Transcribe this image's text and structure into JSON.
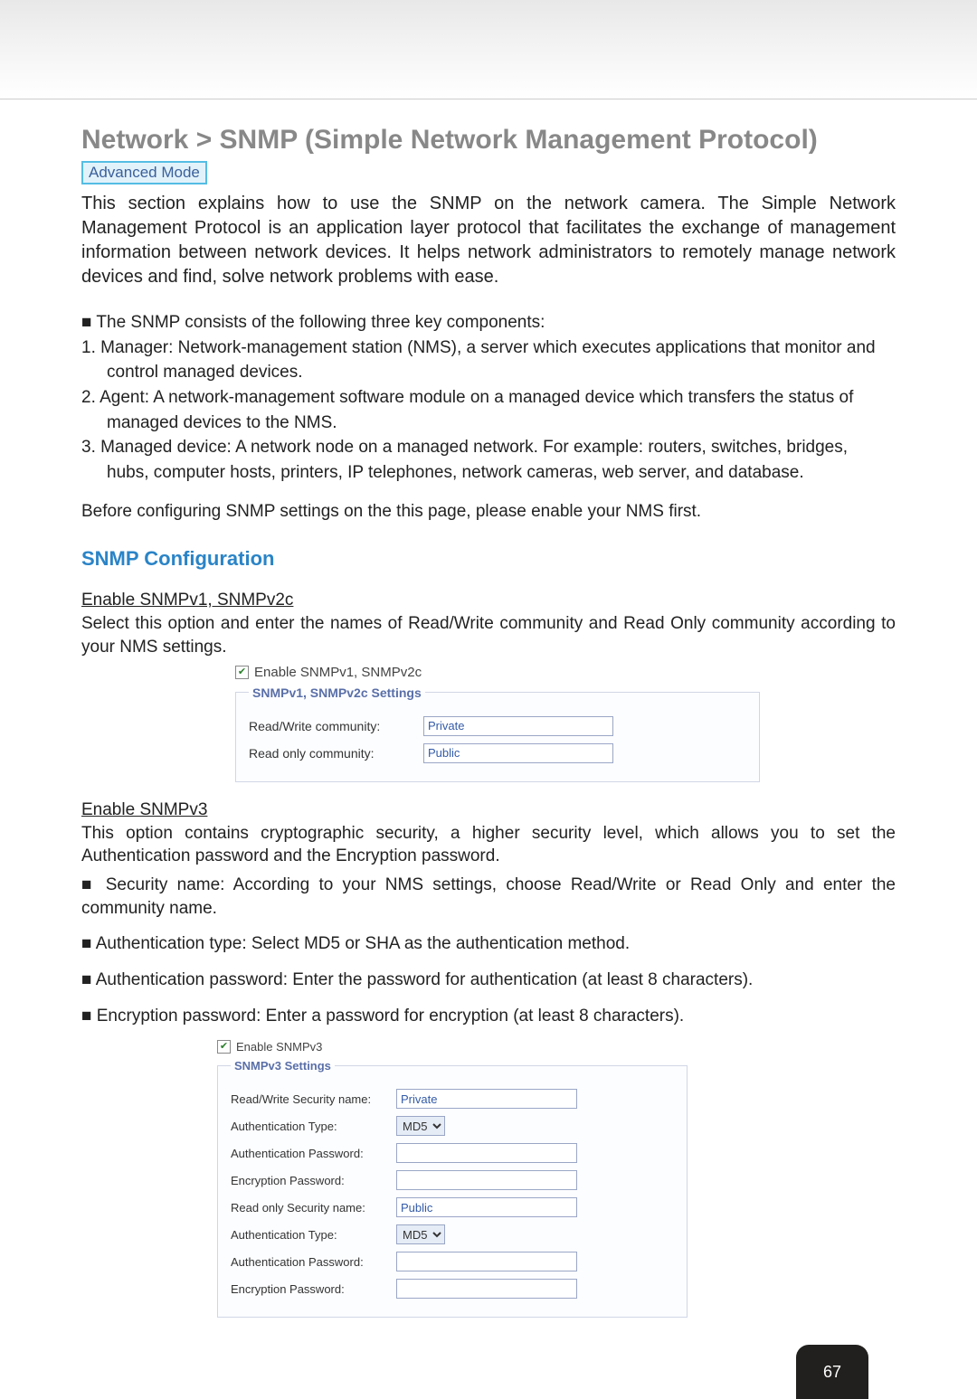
{
  "page_number": "67",
  "heading": "Network > SNMP (Simple Network Management Protocol)",
  "mode_badge": "Advanced Mode",
  "intro": "This section explains how to use the SNMP on the network camera. The Simple Network Management Protocol is an application layer protocol that facilitates the exchange of management information between network devices. It helps network administrators to remotely manage network devices and find, solve network problems with ease.",
  "components_intro": "■ The SNMP consists of the following three key components:",
  "components": [
    {
      "line1": "1. Manager: Network-management station (NMS), a server which executes applications that monitor and",
      "line2": "control managed devices."
    },
    {
      "line1": "2. Agent: A network-management software module on a managed device which transfers the status of",
      "line2": "managed devices to the NMS."
    },
    {
      "line1": "3. Managed device: A network node on a managed network. For example: routers, switches, bridges,",
      "line2": "hubs, computer hosts, printers, IP telephones, network cameras, web server, and database."
    }
  ],
  "before_note": "Before configuring SNMP settings on the this page, please enable your NMS first.",
  "section_title": "SNMP Configuration",
  "v1v2c": {
    "heading": "Enable SNMPv1, SNMPv2c",
    "desc": "Select this option and enter the names of Read/Write community and Read Only community according to your NMS settings.",
    "checkbox_label": "Enable SNMPv1, SNMPv2c",
    "legend": "SNMPv1, SNMPv2c Settings",
    "rw_label": "Read/Write community:",
    "rw_value": "Private",
    "ro_label": "Read only community:",
    "ro_value": "Public"
  },
  "v3": {
    "heading": "Enable SNMPv3",
    "desc": "This option contains cryptographic security, a higher security level, which allows you to set the Authentication password and the Encryption password.",
    "bullets": [
      "■ Security name: According to your NMS settings, choose Read/Write or Read Only and enter the community name.",
      "■ Authentication type: Select MD5 or SHA as the authentication method.",
      "■ Authentication password: Enter the password for authentication (at least 8 characters).",
      "■ Encryption password: Enter a password for encryption (at least 8 characters)."
    ],
    "checkbox_label": "Enable SNMPv3",
    "legend": "SNMPv3 Settings",
    "rw_sec_label": "Read/Write Security name:",
    "rw_sec_value": "Private",
    "auth_type_label": "Authentication Type:",
    "auth_type_value": "MD5",
    "auth_pass_label": "Authentication Password:",
    "enc_pass_label": "Encryption Password:",
    "ro_sec_label": "Read only Security name:",
    "ro_sec_value": "Public"
  }
}
